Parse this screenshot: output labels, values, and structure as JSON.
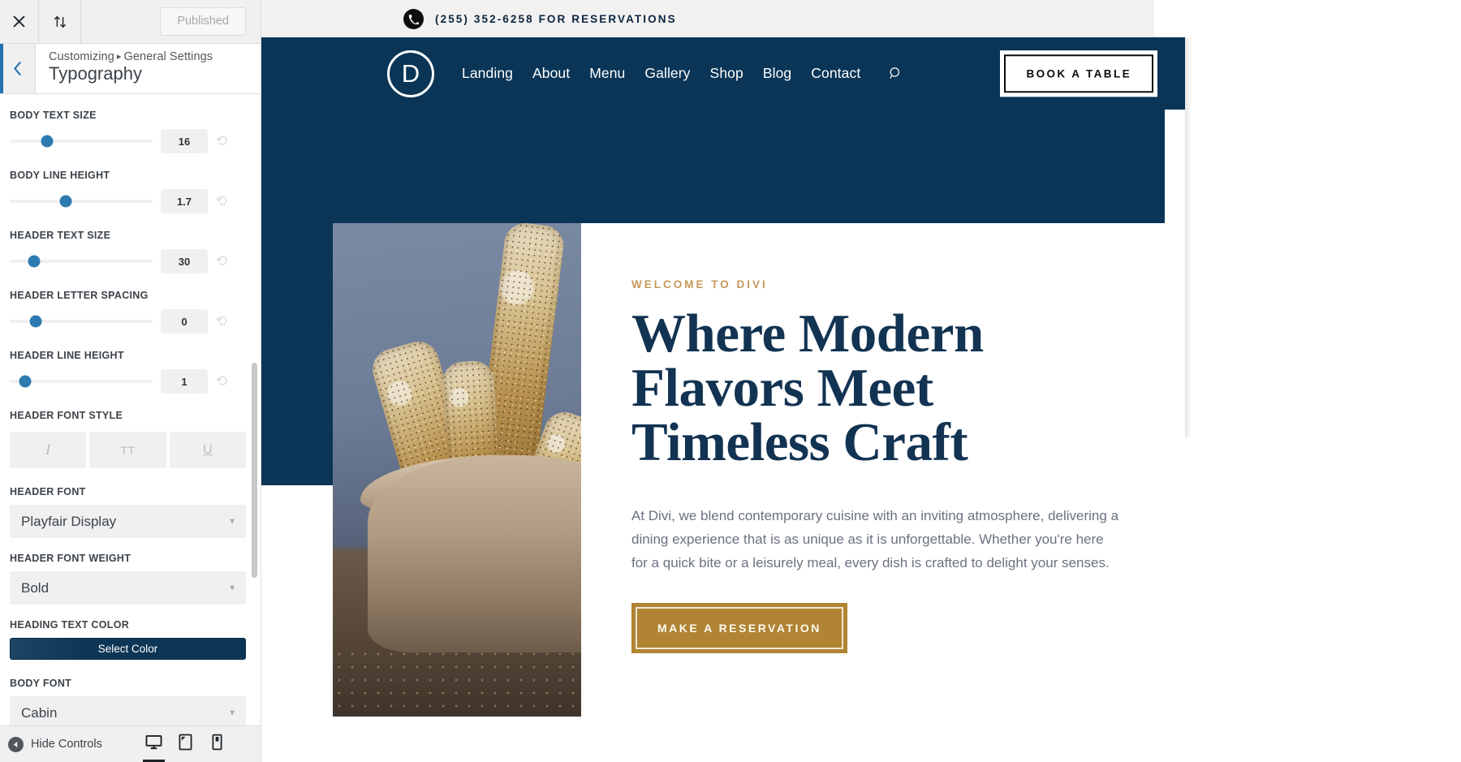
{
  "customizer": {
    "topbar": {
      "close_icon": "close-icon",
      "devices_icon": "sort-updown-icon",
      "published_label": "Published"
    },
    "header": {
      "back_icon": "chevron-left-icon",
      "breadcrumb_root": "Customizing",
      "breadcrumb_separator": "▸",
      "breadcrumb_parent": "General Settings",
      "section_title": "Typography"
    },
    "controls": [
      {
        "label": "BODY TEXT SIZE",
        "value": "16",
        "thumb_pct": 26,
        "reset_icon": "reset-icon"
      },
      {
        "label": "BODY LINE HEIGHT",
        "value": "1.7",
        "thumb_pct": 39,
        "reset_icon": "reset-icon"
      },
      {
        "label": "HEADER TEXT SIZE",
        "value": "30",
        "thumb_pct": 17,
        "reset_icon": "reset-icon"
      },
      {
        "label": "HEADER LETTER SPACING",
        "value": "0",
        "thumb_pct": 18,
        "reset_icon": "reset-icon"
      },
      {
        "label": "HEADER LINE HEIGHT",
        "value": "1",
        "thumb_pct": 11,
        "reset_icon": "reset-icon"
      }
    ],
    "font_style": {
      "label": "HEADER FONT STYLE",
      "buttons": [
        {
          "glyph": "I",
          "name": "italic-button"
        },
        {
          "glyph": "TT",
          "name": "uppercase-button"
        },
        {
          "glyph": "U",
          "name": "underline-button"
        }
      ]
    },
    "header_font": {
      "label": "HEADER FONT",
      "value": "Playfair Display"
    },
    "header_font_weight": {
      "label": "HEADER FONT WEIGHT",
      "value": "Bold"
    },
    "heading_color": {
      "label": "HEADING TEXT COLOR",
      "button_label": "Select Color",
      "swatch": "#0d3656"
    },
    "body_font": {
      "label": "BODY FONT",
      "value": "Cabin"
    },
    "footer": {
      "hide_controls_label": "Hide Controls",
      "devices": [
        {
          "name": "desktop-preview-button",
          "icon": "desktop-icon",
          "active": true
        },
        {
          "name": "tablet-preview-button",
          "icon": "tablet-icon",
          "active": false
        },
        {
          "name": "mobile-preview-button",
          "icon": "mobile-icon",
          "active": false
        }
      ]
    }
  },
  "site": {
    "topbar": {
      "phone_icon": "phone-icon",
      "text": "(255) 352-6258 FOR RESERVATIONS"
    },
    "nav": {
      "logo_letter": "D",
      "links": [
        "Landing",
        "About",
        "Menu",
        "Gallery",
        "Shop",
        "Blog",
        "Contact"
      ],
      "search_icon": "search-icon",
      "cta_label": "BOOK A TABLE"
    },
    "hero": {
      "image_alt": "bread-sticks-in-paper-bag-photo",
      "eyebrow": "WELCOME TO DIVI",
      "heading": "Where Modern Flavors Meet Timeless Craft",
      "paragraph": "At Divi, we blend contemporary cuisine with an inviting atmosphere, delivering a dining experience that is as unique as it is unforgettable. Whether you're here for a quick bite or a leisurely meal, every dish is crafted to delight your senses.",
      "cta_label": "MAKE A RESERVATION"
    },
    "colors": {
      "navy": "#0a3556",
      "heading_navy": "#123352",
      "gold": "#b08433",
      "eyebrow_gold": "#c49a5a"
    }
  }
}
